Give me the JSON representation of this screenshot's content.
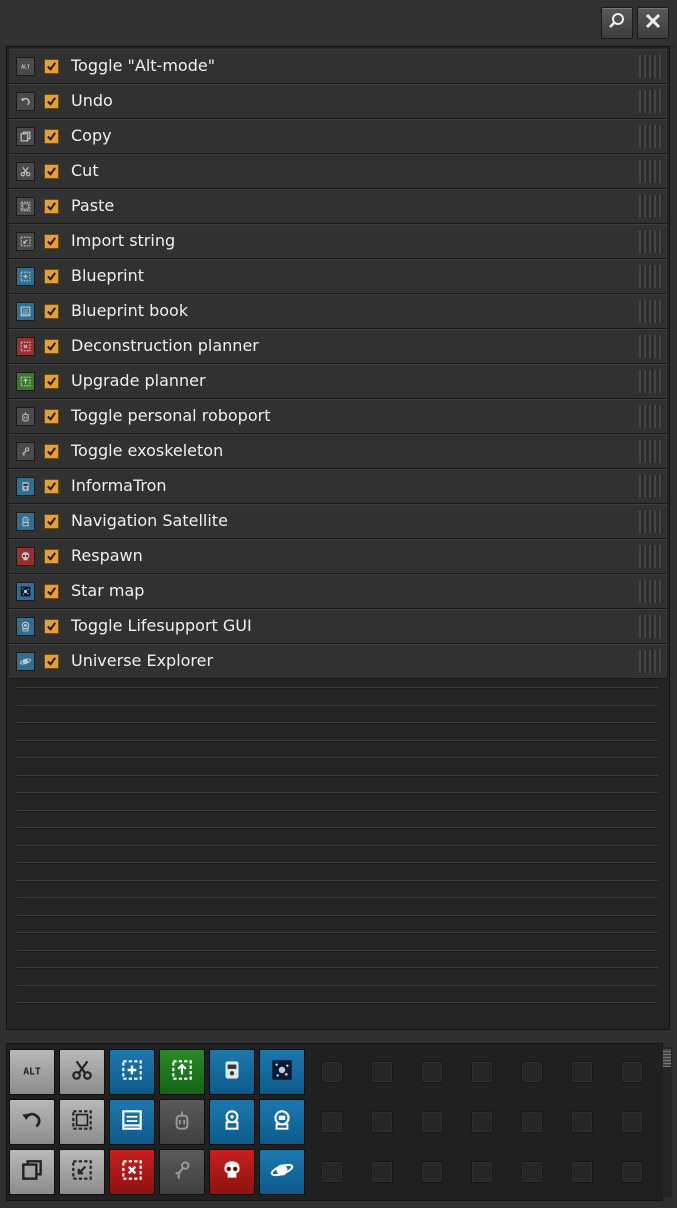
{
  "toolbar": {
    "search_icon": "magnifier-icon",
    "close_icon": "close-x-icon"
  },
  "shortcuts": [
    {
      "label": "Toggle \"Alt-mode\"",
      "icon": "alt-icon",
      "color": "#4a4a4a",
      "enabled": true
    },
    {
      "label": "Undo",
      "icon": "undo-icon",
      "color": "#4a4a4a",
      "enabled": true
    },
    {
      "label": "Copy",
      "icon": "copy-icon",
      "color": "#4a4a4a",
      "enabled": true
    },
    {
      "label": "Cut",
      "icon": "scissors-icon",
      "color": "#4a4a4a",
      "enabled": true
    },
    {
      "label": "Paste",
      "icon": "paste-icon",
      "color": "#4a4a4a",
      "enabled": true
    },
    {
      "label": "Import string",
      "icon": "import-string-icon",
      "color": "#4a4a4a",
      "enabled": true
    },
    {
      "label": "Blueprint",
      "icon": "blueprint-icon",
      "color": "#2f6f93",
      "enabled": true
    },
    {
      "label": "Blueprint book",
      "icon": "blueprint-book-icon",
      "color": "#2f6f93",
      "enabled": true
    },
    {
      "label": "Deconstruction planner",
      "icon": "deconstruction-planner-icon",
      "color": "#9a2f2f",
      "enabled": true
    },
    {
      "label": "Upgrade planner",
      "icon": "upgrade-planner-icon",
      "color": "#3a7a2a",
      "enabled": true
    },
    {
      "label": "Toggle personal roboport",
      "icon": "roboport-icon",
      "color": "#4a4a4a",
      "enabled": true
    },
    {
      "label": "Toggle exoskeleton",
      "icon": "exoskeleton-icon",
      "color": "#4a4a4a",
      "enabled": true
    },
    {
      "label": "InformaTron",
      "icon": "informatron-icon",
      "color": "#2f6f93",
      "enabled": true
    },
    {
      "label": "Navigation Satellite",
      "icon": "navigation-satellite-icon",
      "color": "#2f6f93",
      "enabled": true
    },
    {
      "label": "Respawn",
      "icon": "skull-icon",
      "color": "#9a2f2f",
      "enabled": true
    },
    {
      "label": "Star map",
      "icon": "star-map-icon",
      "color": "#2f6f93",
      "enabled": true
    },
    {
      "label": "Toggle Lifesupport GUI",
      "icon": "lifesupport-icon",
      "color": "#2f6f93",
      "enabled": true
    },
    {
      "label": "Universe Explorer",
      "icon": "planet-icon",
      "color": "#2f6f93",
      "enabled": true
    }
  ],
  "quickbar": {
    "slots": [
      {
        "icon": "alt-icon",
        "style": "grey"
      },
      {
        "icon": "scissors-icon",
        "style": "grey"
      },
      {
        "icon": "blueprint-icon",
        "style": "blue"
      },
      {
        "icon": "upgrade-planner-icon",
        "style": "green"
      },
      {
        "icon": "informatron-icon",
        "style": "blue"
      },
      {
        "icon": "star-map-icon",
        "style": "blue"
      },
      {
        "icon": "undo-icon",
        "style": "grey"
      },
      {
        "icon": "paste-icon",
        "style": "grey"
      },
      {
        "icon": "blueprint-book-icon",
        "style": "blue"
      },
      {
        "icon": "roboport-icon",
        "style": "dark"
      },
      {
        "icon": "navigation-satellite-icon",
        "style": "blue"
      },
      {
        "icon": "lifesupport-icon",
        "style": "blue"
      },
      {
        "icon": "copy-icon",
        "style": "grey"
      },
      {
        "icon": "import-string-icon",
        "style": "grey"
      },
      {
        "icon": "deconstruction-planner-icon",
        "style": "red"
      },
      {
        "icon": "exoskeleton-icon",
        "style": "dark"
      },
      {
        "icon": "skull-icon",
        "style": "red"
      },
      {
        "icon": "planet-icon",
        "style": "blue"
      }
    ],
    "empty_slot_columns": 7,
    "rows": 3
  },
  "colors": {
    "checkbox": "#e3a03a",
    "background": "#2f2f30",
    "row": "#313132"
  }
}
